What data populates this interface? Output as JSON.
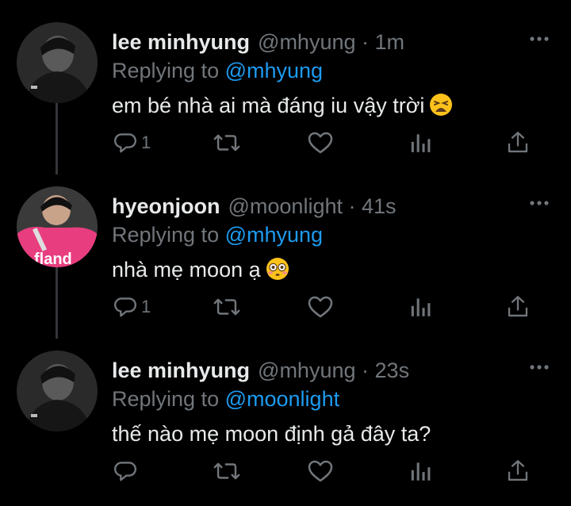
{
  "tweets": [
    {
      "name": "lee minhyung",
      "handle": "@mhyung",
      "dot": "·",
      "time": "1m",
      "replying_prefix": "Replying to",
      "replying_to": "@mhyung",
      "text": "em bé nhà ai mà đáng iu vậy trời",
      "text_emoji": "weary-face",
      "reply_count": "1",
      "avatar": "grayscale-portrait"
    },
    {
      "name": "hyeonjoon",
      "handle": "@moonlight",
      "dot": "·",
      "time": "41s",
      "replying_prefix": "Replying to",
      "replying_to": "@mhyung",
      "text": "nhà mẹ moon ạ",
      "text_emoji": "flushed-face",
      "reply_count": "1",
      "avatar": "pink-jersey-portrait",
      "avatar_jersey_text": "fland"
    },
    {
      "name": "lee minhyung",
      "handle": "@mhyung",
      "dot": "·",
      "time": "23s",
      "replying_prefix": "Replying to",
      "replying_to": "@moonlight",
      "text": "thế nào mẹ moon định gả đây ta?",
      "reply_count": "",
      "avatar": "grayscale-portrait"
    }
  ],
  "colors": {
    "background": "#000000",
    "text": "#e7e9ea",
    "secondary": "#71767b",
    "link": "#1d9bf0",
    "thread_line": "#333639",
    "jersey_pink": "#e83d7f"
  },
  "icons": [
    "reply-icon",
    "retweet-icon",
    "like-icon",
    "analytics-icon",
    "share-icon",
    "more-icon"
  ]
}
